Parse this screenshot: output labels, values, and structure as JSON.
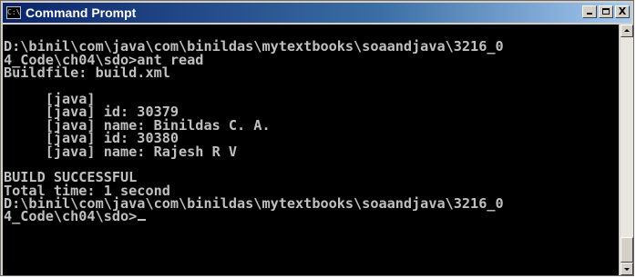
{
  "window": {
    "title": "Command Prompt",
    "icon": "cmd-icon",
    "icon_text": "C:\\",
    "buttons": {
      "minimize": "minimize-icon",
      "maximize": "maximize-icon",
      "close": "close-icon",
      "close_glyph": "X"
    }
  },
  "console": {
    "lines": [
      "",
      "D:\\binil\\com\\java\\com\\binildas\\mytextbooks\\soaandjava\\3216_0",
      "4_Code\\ch04\\sdo>ant read",
      "Buildfile: build.xml",
      "",
      "     [java]",
      "     [java] id: 30379",
      "     [java] name: Binildas C. A.",
      "     [java] id: 30380",
      "     [java] name: Rajesh R V",
      "",
      "BUILD SUCCESSFUL",
      "Total time: 1 second",
      "D:\\binil\\com\\java\\com\\binildas\\mytextbooks\\soaandjava\\3216_0",
      "4_Code\\ch04\\sdo>"
    ]
  },
  "scrollbar": {
    "position": 1.0
  },
  "colors": {
    "console_background": "#000000",
    "console_text": "#c0c0c0",
    "titlebar_start": "#0a246a",
    "titlebar_end": "#a6caf0"
  }
}
